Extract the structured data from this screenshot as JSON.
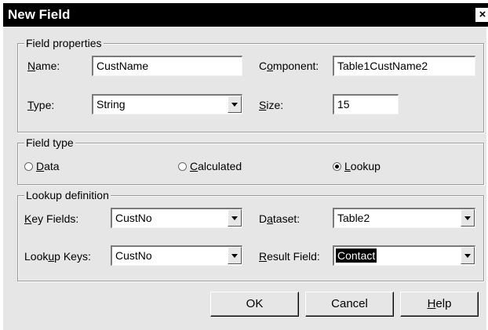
{
  "window": {
    "title": "New Field",
    "close_glyph": "×"
  },
  "field_properties": {
    "legend": "Field properties",
    "name_label": {
      "pre": "",
      "key": "N",
      "post": "ame:"
    },
    "name_value": "CustName",
    "component_label": {
      "pre": "C",
      "key": "o",
      "post": "mponent:"
    },
    "component_value": "Table1CustName2",
    "type_label": {
      "pre": "",
      "key": "T",
      "post": "ype:"
    },
    "type_value": "String",
    "size_label": {
      "pre": "",
      "key": "S",
      "post": "ize:"
    },
    "size_value": "15"
  },
  "field_type": {
    "legend": "Field type",
    "options": [
      {
        "pre": "",
        "key": "D",
        "post": "ata",
        "checked": false
      },
      {
        "pre": "",
        "key": "C",
        "post": "alculated",
        "checked": false
      },
      {
        "pre": "",
        "key": "L",
        "post": "ookup",
        "checked": true
      }
    ]
  },
  "lookup_definition": {
    "legend": "Lookup definition",
    "key_fields_label": {
      "pre": "",
      "key": "K",
      "post": "ey Fields:"
    },
    "key_fields_value": "CustNo",
    "dataset_label": {
      "pre": "D",
      "key": "a",
      "post": "taset:"
    },
    "dataset_value": "Table2",
    "lookup_keys_label": {
      "pre": "Look",
      "key": "u",
      "post": "p Keys:"
    },
    "lookup_keys_value": "CustNo",
    "result_field_label": {
      "pre": "",
      "key": "R",
      "post": "esult Field:"
    },
    "result_field_value": "Contact"
  },
  "buttons": {
    "ok": {
      "pre": "OK",
      "key": "",
      "post": ""
    },
    "cancel": {
      "pre": "Cancel",
      "key": "",
      "post": ""
    },
    "help": {
      "pre": "",
      "key": "H",
      "post": "elp"
    }
  }
}
